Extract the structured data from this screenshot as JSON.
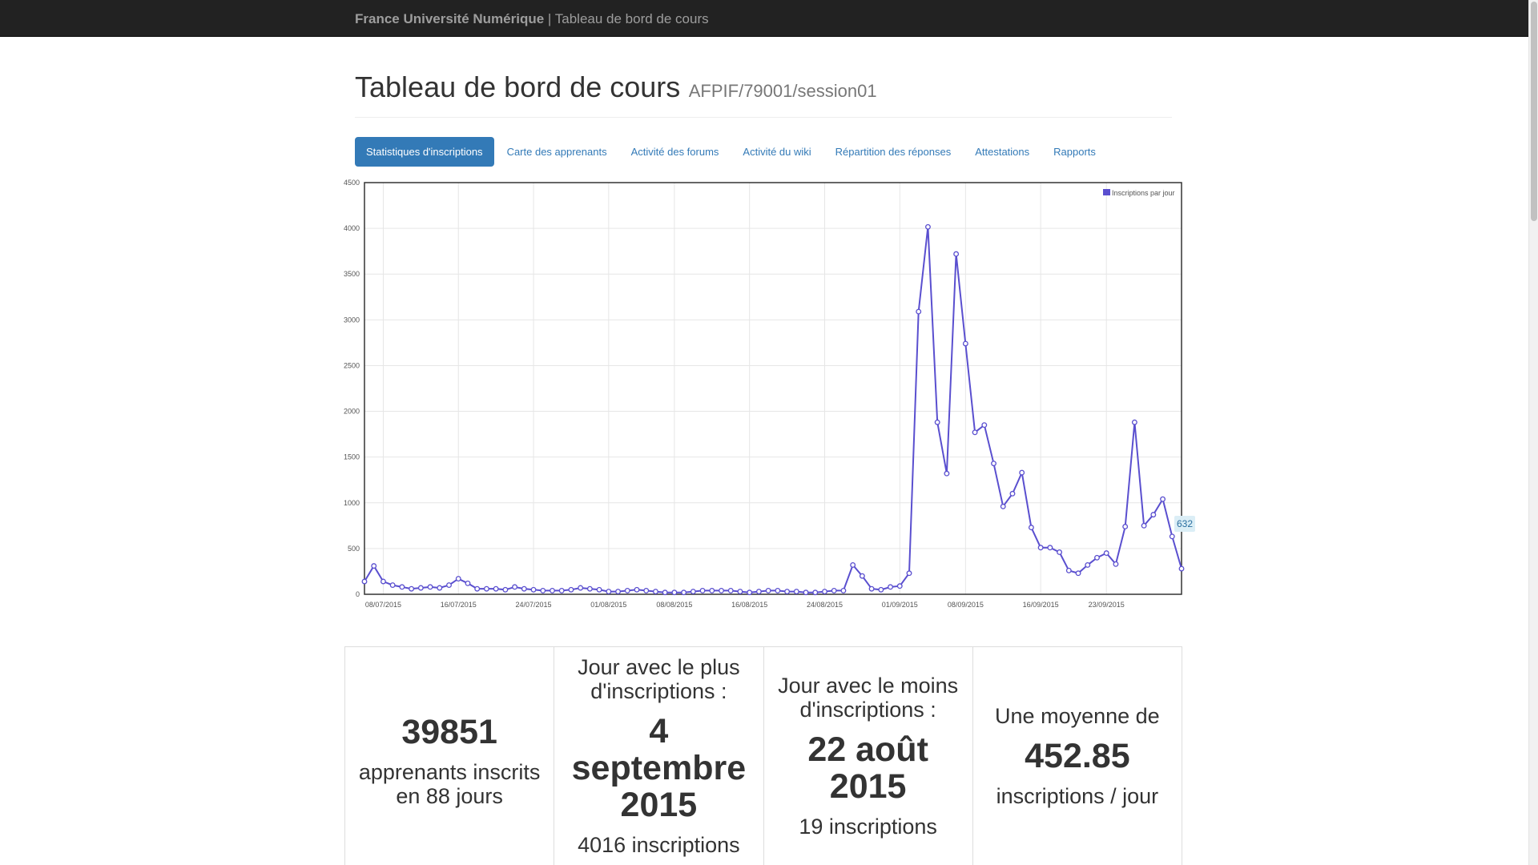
{
  "navbar": {
    "brand": "France Université Numérique",
    "separator": " | ",
    "subtitle": "Tableau de bord de cours"
  },
  "header": {
    "title": "Tableau de bord de cours",
    "course_id": "AFPIF/79001/session01"
  },
  "tabs": [
    {
      "label": "Statistiques d'inscriptions",
      "active": true
    },
    {
      "label": "Carte des apprenants",
      "active": false
    },
    {
      "label": "Activité des forums",
      "active": false
    },
    {
      "label": "Activité du wiki",
      "active": false
    },
    {
      "label": "Répartition des réponses",
      "active": false
    },
    {
      "label": "Attestations",
      "active": false
    },
    {
      "label": "Rapports",
      "active": false
    }
  ],
  "chart_data": {
    "type": "line",
    "title": "",
    "xlabel": "",
    "ylabel": "",
    "ylim": [
      0,
      4500
    ],
    "y_ticks": [
      0,
      500,
      1000,
      1500,
      2000,
      2500,
      3000,
      3500,
      4000,
      4500
    ],
    "x_tick_labels": [
      "08/07/2015",
      "16/07/2015",
      "24/07/2015",
      "01/08/2015",
      "08/08/2015",
      "16/08/2015",
      "24/08/2015",
      "01/09/2015",
      "08/09/2015",
      "16/09/2015",
      "23/09/2015"
    ],
    "x_start": "06/07/2015",
    "grid": true,
    "legend_position": "top-right",
    "series": [
      {
        "name": "Inscriptions par jour",
        "color": "#5a4fcf",
        "values": [
          140,
          310,
          140,
          100,
          80,
          60,
          70,
          80,
          70,
          100,
          170,
          120,
          60,
          60,
          60,
          50,
          80,
          60,
          50,
          40,
          40,
          40,
          50,
          70,
          60,
          50,
          30,
          30,
          40,
          50,
          40,
          30,
          20,
          20,
          20,
          30,
          40,
          40,
          40,
          40,
          30,
          20,
          30,
          40,
          40,
          30,
          30,
          20,
          20,
          30,
          40,
          40,
          320,
          200,
          60,
          50,
          80,
          90,
          230,
          3090,
          4016,
          1880,
          1320,
          3720,
          2740,
          1770,
          1850,
          1430,
          960,
          1100,
          1330,
          730,
          510,
          510,
          460,
          260,
          230,
          320,
          400,
          450,
          330,
          740,
          1880,
          750,
          870,
          1040,
          632,
          280
        ]
      }
    ],
    "tooltip": "632"
  },
  "stats": [
    {
      "label": "",
      "big": "39851",
      "sub": "apprenants inscrits en 88 jours"
    },
    {
      "label": "Jour avec le plus d'inscriptions :",
      "big": "4 septembre 2015",
      "sub": "4016 inscriptions"
    },
    {
      "label": "Jour avec le moins d'inscriptions :",
      "big": "22 août 2015",
      "sub": "19 inscriptions"
    },
    {
      "label": "Une moyenne de",
      "big": "452.85",
      "sub": "inscriptions / jour"
    }
  ]
}
